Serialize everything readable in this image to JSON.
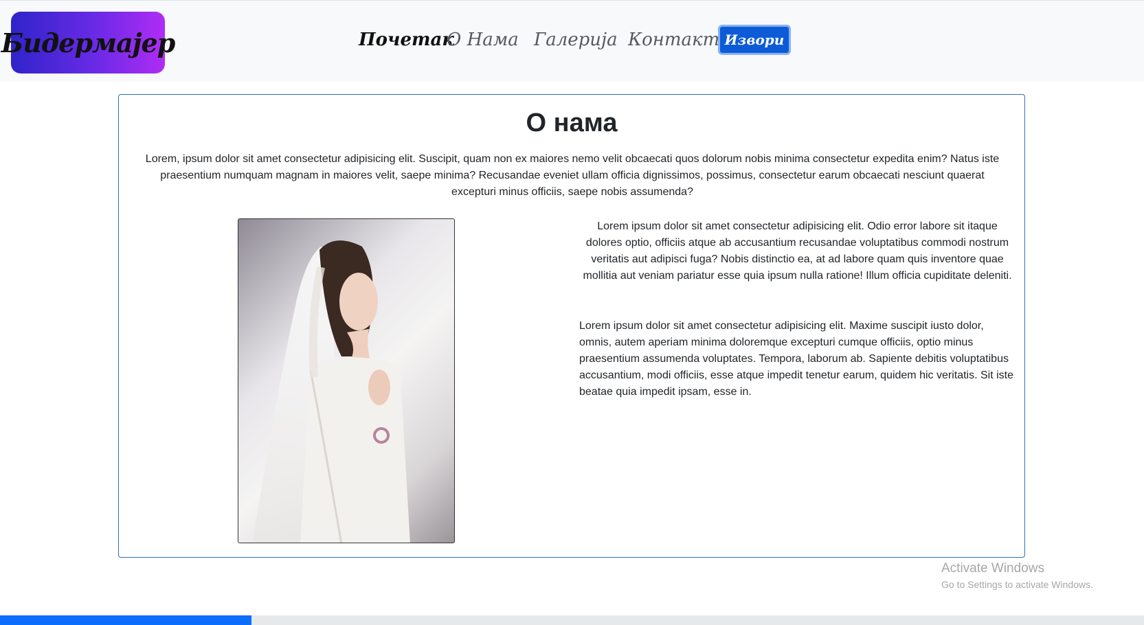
{
  "navbar": {
    "logo_text": "Бидермајер",
    "links": [
      {
        "label": "Почетак"
      },
      {
        "label": "О Нама"
      },
      {
        "label": "Галерија"
      },
      {
        "label": "Контакт"
      }
    ],
    "button_label": "Извори"
  },
  "main": {
    "title": "О нама",
    "intro": "Lorem, ipsum dolor sit amet consectetur adipisicing elit. Suscipit, quam non ex maiores nemo velit obcaecati quos dolorum nobis minima consectetur expedita enim? Natus iste praesentium numquam magnam in maiores velit, saepe minima? Recusandae eveniet ullam officia dignissimos, possimus, consectetur earum obcaecati nesciunt quaerat excepturi minus officiis, saepe nobis assumenda?",
    "paragraph1": "Lorem ipsum dolor sit amet consectetur adipisicing elit. Odio error labore sit itaque dolores optio, officiis atque ab accusantium recusandae voluptatibus commodi nostrum veritatis aut adipisci fuga? Nobis distinctio ea, at ad labore quam quis inventore quae mollitia aut veniam pariatur esse quia ipsum nulla ratione! Illum officia cupiditate deleniti.",
    "paragraph2": "Lorem ipsum dolor sit amet consectetur adipisicing elit. Maxime suscipit iusto dolor, omnis, autem aperiam minima doloremque excepturi cumque officiis, optio minus praesentium assumenda voluptates. Tempora, laborum ab. Sapiente debitis voluptatibus accusantium, modi officiis, esse atque impedit tenetur earum, quidem hic veritatis. Sit iste beatae quia impedit ipsam, esse in."
  },
  "watermark": {
    "title": "Activate Windows",
    "subtitle": "Go to Settings to activate Windows."
  },
  "colors": {
    "accent": "#0d6efd",
    "logo_gradient_start": "#2f24c9",
    "logo_gradient_end": "#b02cf5",
    "card_border": "#2f6fb5"
  }
}
